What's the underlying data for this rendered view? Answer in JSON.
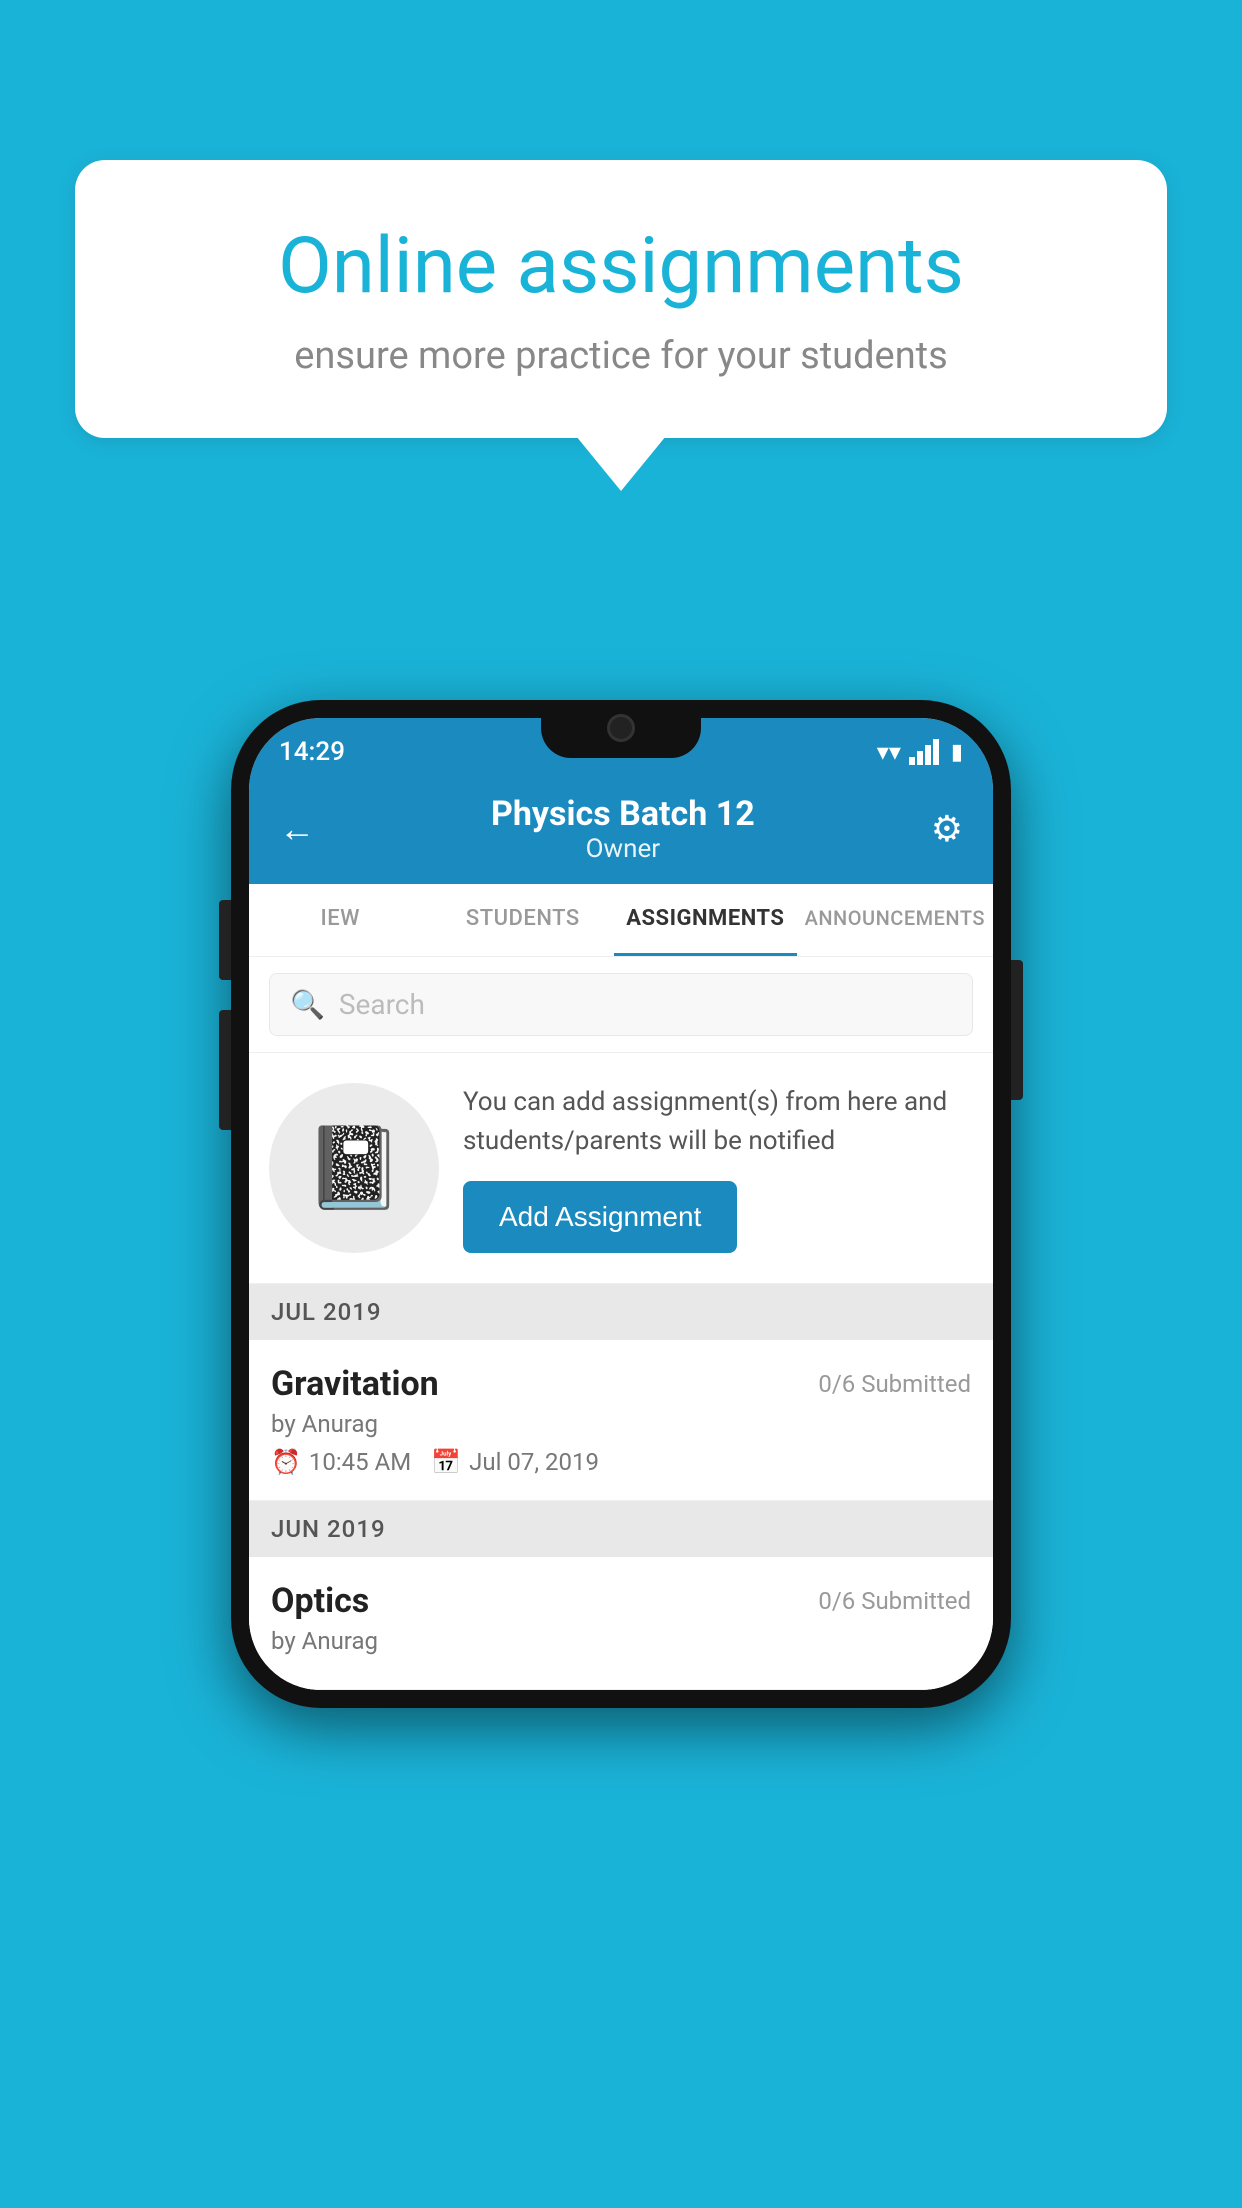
{
  "background_color": "#1ab3d8",
  "speech_bubble": {
    "title": "Online assignments",
    "subtitle": "ensure more practice for your students"
  },
  "phone": {
    "status_bar": {
      "time": "14:29",
      "wifi": "wifi",
      "signal": "signal",
      "battery": "battery"
    },
    "header": {
      "title": "Physics Batch 12",
      "subtitle": "Owner",
      "back_icon": "back-arrow",
      "settings_icon": "gear"
    },
    "tabs": [
      {
        "label": "IEW",
        "active": false
      },
      {
        "label": "STUDENTS",
        "active": false
      },
      {
        "label": "ASSIGNMENTS",
        "active": true
      },
      {
        "label": "ANNOUNCEMENTS",
        "active": false
      }
    ],
    "search": {
      "placeholder": "Search"
    },
    "promo": {
      "description": "You can add assignment(s) from here and students/parents will be notified",
      "button_label": "Add Assignment"
    },
    "sections": [
      {
        "label": "JUL 2019",
        "assignments": [
          {
            "name": "Gravitation",
            "submitted": "0/6 Submitted",
            "author": "by Anurag",
            "time": "10:45 AM",
            "date": "Jul 07, 2019"
          }
        ]
      },
      {
        "label": "JUN 2019",
        "assignments": [
          {
            "name": "Optics",
            "submitted": "0/6 Submitted",
            "author": "by Anurag",
            "time": "",
            "date": ""
          }
        ]
      }
    ]
  }
}
